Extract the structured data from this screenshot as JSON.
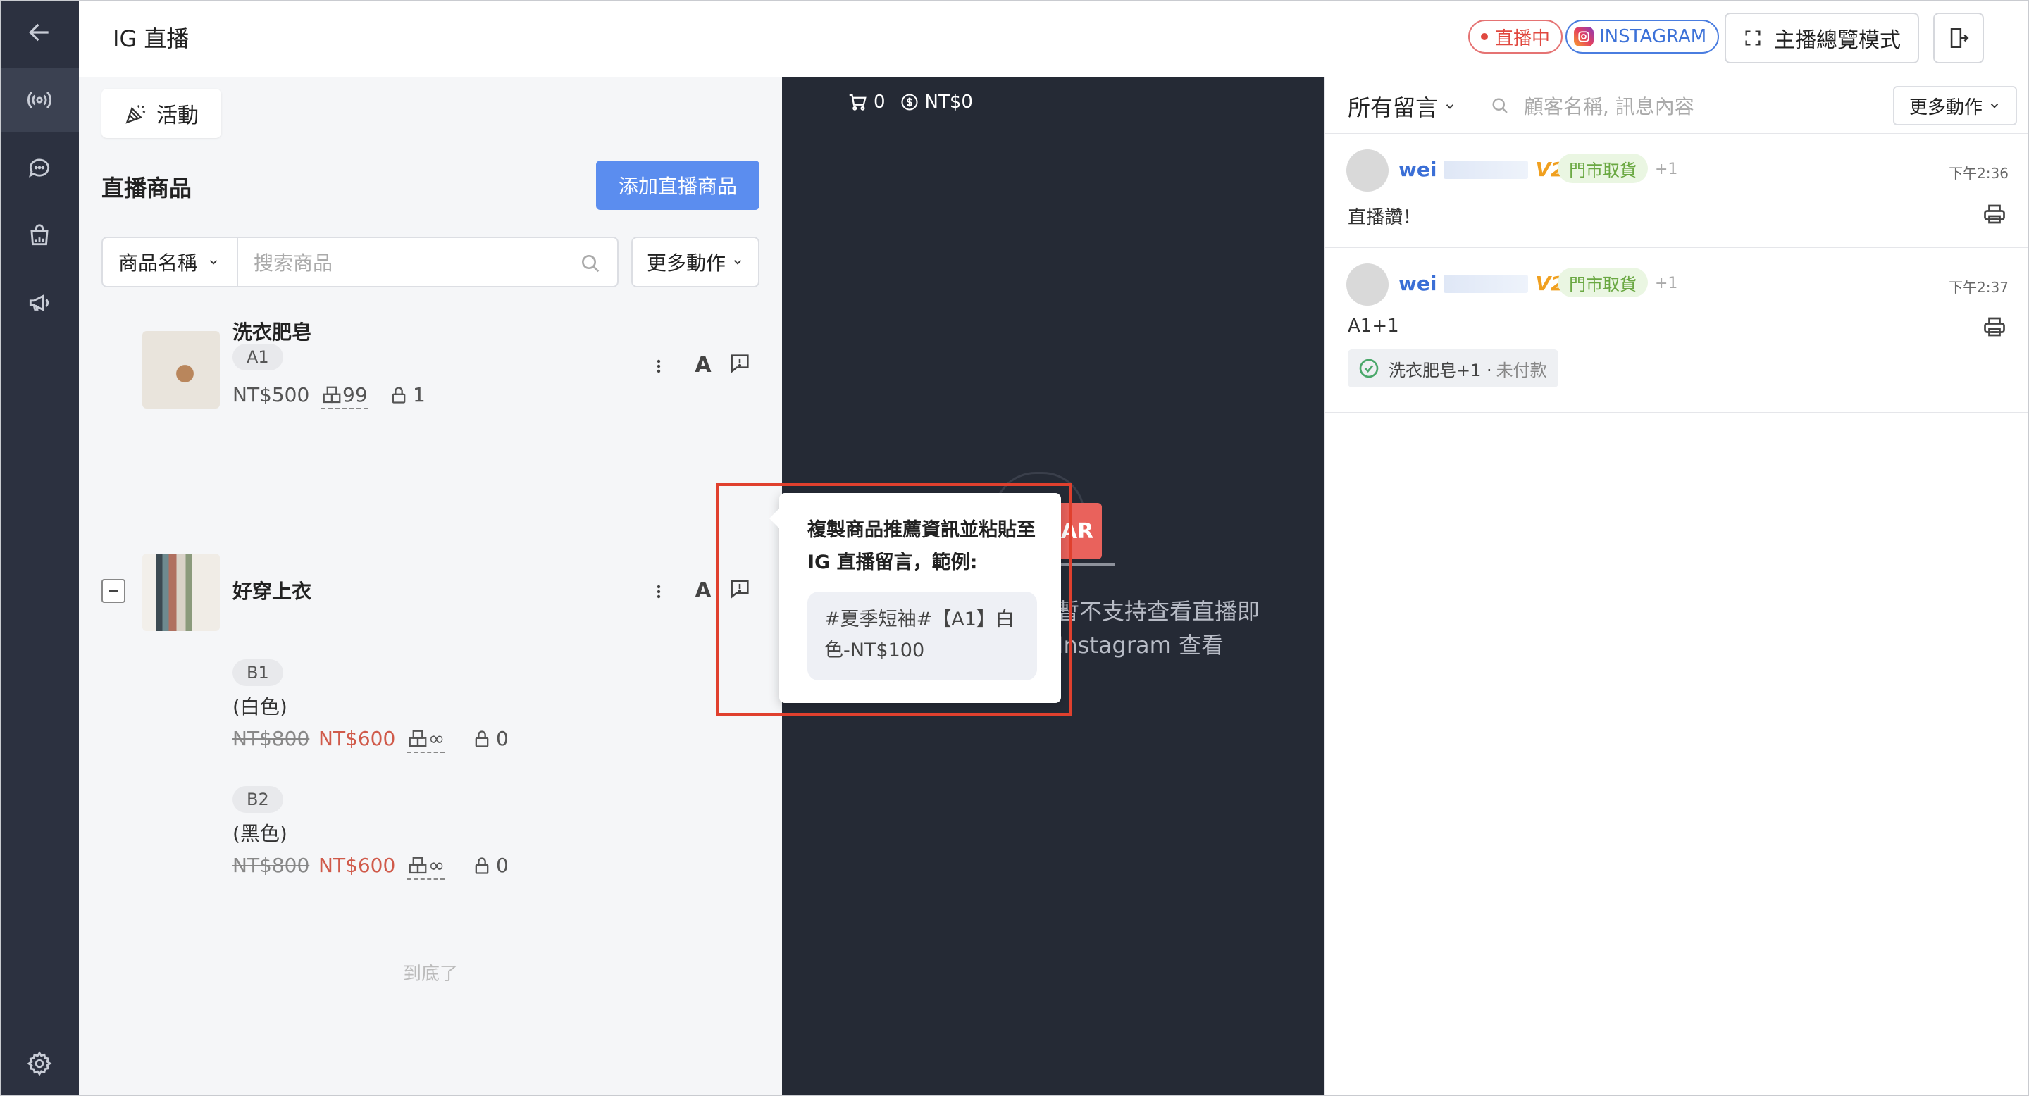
{
  "header": {
    "title": "IG 直播",
    "live_status": "直播中",
    "platform": "INSTAGRAM",
    "overview_label": "主播總覽模式"
  },
  "left": {
    "activity_label": "活動",
    "products_title": "直播商品",
    "add_product_label": "添加直播商品",
    "filter_label": "商品名稱",
    "search_placeholder": "搜索商品",
    "more_actions_label": "更多動作",
    "products": [
      {
        "name": "洗衣肥皂",
        "code": "A1",
        "price": "NT$500",
        "stock": "99",
        "locked": "1"
      },
      {
        "name": "好穿上衣",
        "variants": [
          {
            "code": "B1",
            "label": "(白色)",
            "old_price": "NT$800",
            "price": "NT$600",
            "stock": "∞",
            "locked": "0"
          },
          {
            "code": "B2",
            "label": "(黑色)",
            "old_price": "NT$800",
            "price": "NT$600",
            "stock": "∞",
            "locked": "0"
          }
        ]
      }
    ],
    "end_text": "到底了"
  },
  "video": {
    "cart_count": "0",
    "cart_total": "NT$0",
    "ar_text": "AR",
    "notice_line1": "暫不支持查看直播即",
    "notice_line2": "Instagram 查看"
  },
  "tooltip": {
    "title": "複製商品推薦資訊並粘貼至 IG 直播留言，範例:",
    "example": "#夏季短袖#【A1】白色-NT$100"
  },
  "comments": {
    "filter_label": "所有留言",
    "search_placeholder": "顧客名稱, 訊息內容",
    "more_actions_label": "更多動作",
    "items": [
      {
        "user": "wei",
        "vip": "V2",
        "tag": "門市取貨",
        "plus": "+1",
        "time": "下午2:36",
        "text": "直播讚！"
      },
      {
        "user": "wei",
        "vip": "V2",
        "tag": "門市取貨",
        "plus": "+1",
        "time": "下午2:37",
        "text": "A1+1",
        "order_item": "洗衣肥皂+1 ·",
        "order_status": "未付款"
      }
    ]
  },
  "colors": {
    "rail": "#2c3140",
    "accent": "#5b8def",
    "live_red": "#e0483f",
    "video_bg": "#252a35",
    "highlight": "#e0402e"
  }
}
